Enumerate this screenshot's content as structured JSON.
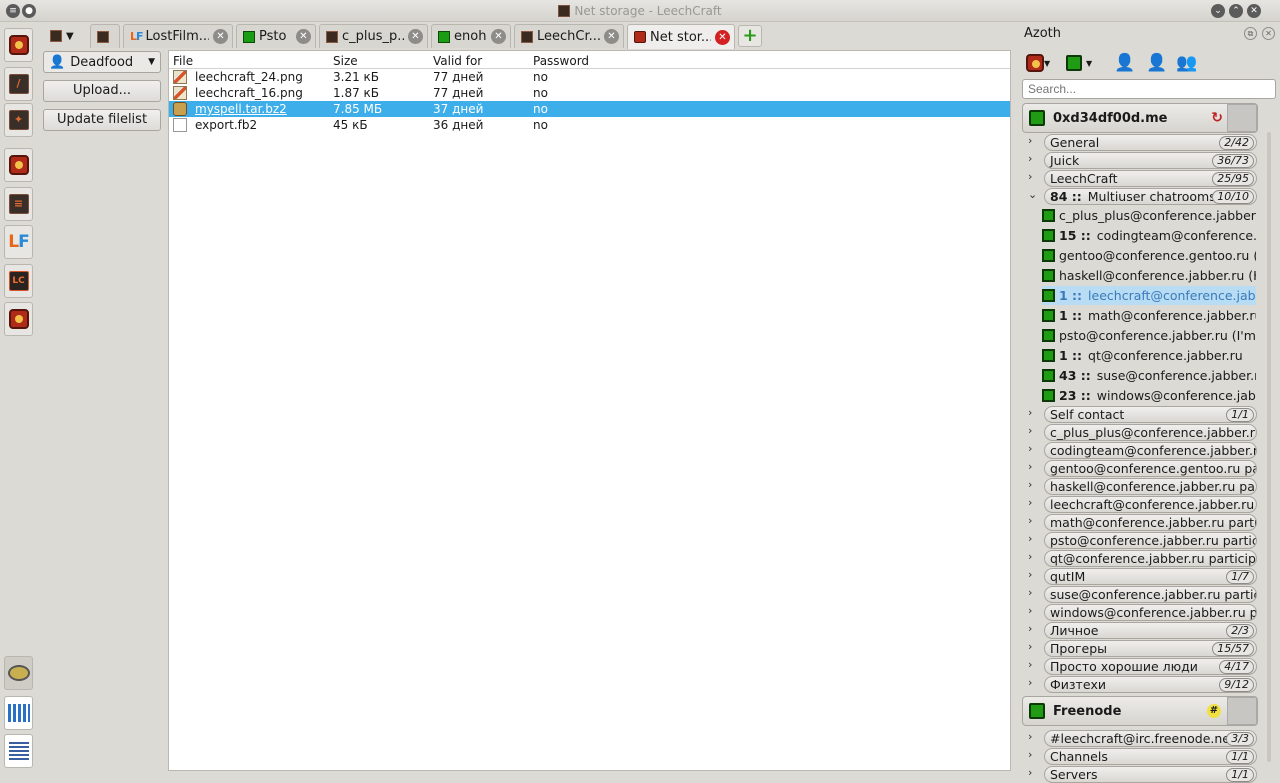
{
  "window": {
    "title": "Net storage - LeechCraft"
  },
  "tabs": [
    {
      "label": "",
      "icon": "leechcraft-icon",
      "kind": "menu"
    },
    {
      "label": "",
      "icon": "dark-tab-icon",
      "kind": "plain"
    },
    {
      "label": "LostFilm....",
      "icon": "lf-icon"
    },
    {
      "label": "Psto",
      "icon": "green-status-icon"
    },
    {
      "label": "c_plus_p...",
      "icon": "dark-tab-icon"
    },
    {
      "label": "enoh",
      "icon": "green-status-icon"
    },
    {
      "label": "LeechCr...",
      "icon": "leechcraft-icon"
    },
    {
      "label": "Net stor...",
      "icon": "net-storage-icon",
      "active": true
    }
  ],
  "storage": {
    "service": "Deadfood",
    "upload_label": "Upload...",
    "update_label": "Update filelist",
    "columns": [
      "File",
      "Size",
      "Valid for",
      "Password"
    ],
    "files": [
      {
        "name": "leechcraft_24.png",
        "size": "3.21 кБ",
        "valid": "77 дней",
        "password": "no",
        "icon": "png"
      },
      {
        "name": "leechcraft_16.png",
        "size": "1.87 кБ",
        "valid": "77 дней",
        "password": "no",
        "icon": "png"
      },
      {
        "name": "myspell.tar.bz2",
        "size": "7.85 МБ",
        "valid": "37 дней",
        "password": "no",
        "icon": "archive",
        "selected": true
      },
      {
        "name": "export.fb2",
        "size": "45 кБ",
        "valid": "36 дней",
        "password": "no",
        "icon": "doc"
      }
    ]
  },
  "azoth": {
    "title": "Azoth",
    "search_placeholder": "Search...",
    "account1": {
      "name": "0xd34df00d.me"
    },
    "groups_top": [
      {
        "name": "General",
        "count": "2/42"
      },
      {
        "name": "Juick",
        "count": "36/73"
      },
      {
        "name": "LeechCraft",
        "count": "25/95"
      }
    ],
    "muc_group": {
      "prefix": "84 ::",
      "name": "Multiuser chatrooms",
      "count": "10/10"
    },
    "rooms": [
      {
        "unread": "",
        "name": "c_plus_plus@conference.jabber.ru"
      },
      {
        "unread": "15 ::",
        "name": "codingteam@conference.jabber.ru"
      },
      {
        "unread": "",
        "name": "gentoo@conference.gentoo.ru (Gentoo)"
      },
      {
        "unread": "",
        "name": "haskell@conference.jabber.ru (Haskell)"
      },
      {
        "unread": "1 ::",
        "name": "leechcraft@conference.jabber.ru",
        "selected": true
      },
      {
        "unread": "1 ::",
        "name": "math@conference.jabber.ru"
      },
      {
        "unread": "",
        "name": "psto@conference.jabber.ru (I'm psto)"
      },
      {
        "unread": "1 ::",
        "name": "qt@conference.jabber.ru"
      },
      {
        "unread": "43 ::",
        "name": "suse@conference.jabber.ru"
      },
      {
        "unread": "23 ::",
        "name": "windows@conference.jabber.ru"
      }
    ],
    "groups_bottom": [
      {
        "name": "Self contact",
        "count": "1/1"
      },
      {
        "name": "c_plus_plus@conference.jabber.ru participants",
        "count": ""
      },
      {
        "name": "codingteam@conference.jabber.ru participants",
        "count": ""
      },
      {
        "name": "gentoo@conference.gentoo.ru participants",
        "count": ""
      },
      {
        "name": "haskell@conference.jabber.ru participants",
        "count": ""
      },
      {
        "name": "leechcraft@conference.jabber.ru participants",
        "count": ""
      },
      {
        "name": "math@conference.jabber.ru participants",
        "count": ""
      },
      {
        "name": "psto@conference.jabber.ru participants",
        "count": ""
      },
      {
        "name": "qt@conference.jabber.ru participants",
        "count": ""
      },
      {
        "name": "qutIM",
        "count": "1/7"
      },
      {
        "name": "suse@conference.jabber.ru participants",
        "count": ""
      },
      {
        "name": "windows@conference.jabber.ru participants",
        "count": ""
      },
      {
        "name": "Личное",
        "count": "2/3"
      },
      {
        "name": "Прогеры",
        "count": "15/57"
      },
      {
        "name": "Просто хорошие люди",
        "count": "4/17"
      },
      {
        "name": "Физтехи",
        "count": "9/12"
      }
    ],
    "account2": {
      "name": "Freenode",
      "badge": "#"
    },
    "groups_account2": [
      {
        "name": "#leechcraft@irc.freenode.net",
        "count": "3/3"
      },
      {
        "name": "Channels",
        "count": "1/1"
      },
      {
        "name": "Servers",
        "count": "1/1"
      }
    ]
  }
}
